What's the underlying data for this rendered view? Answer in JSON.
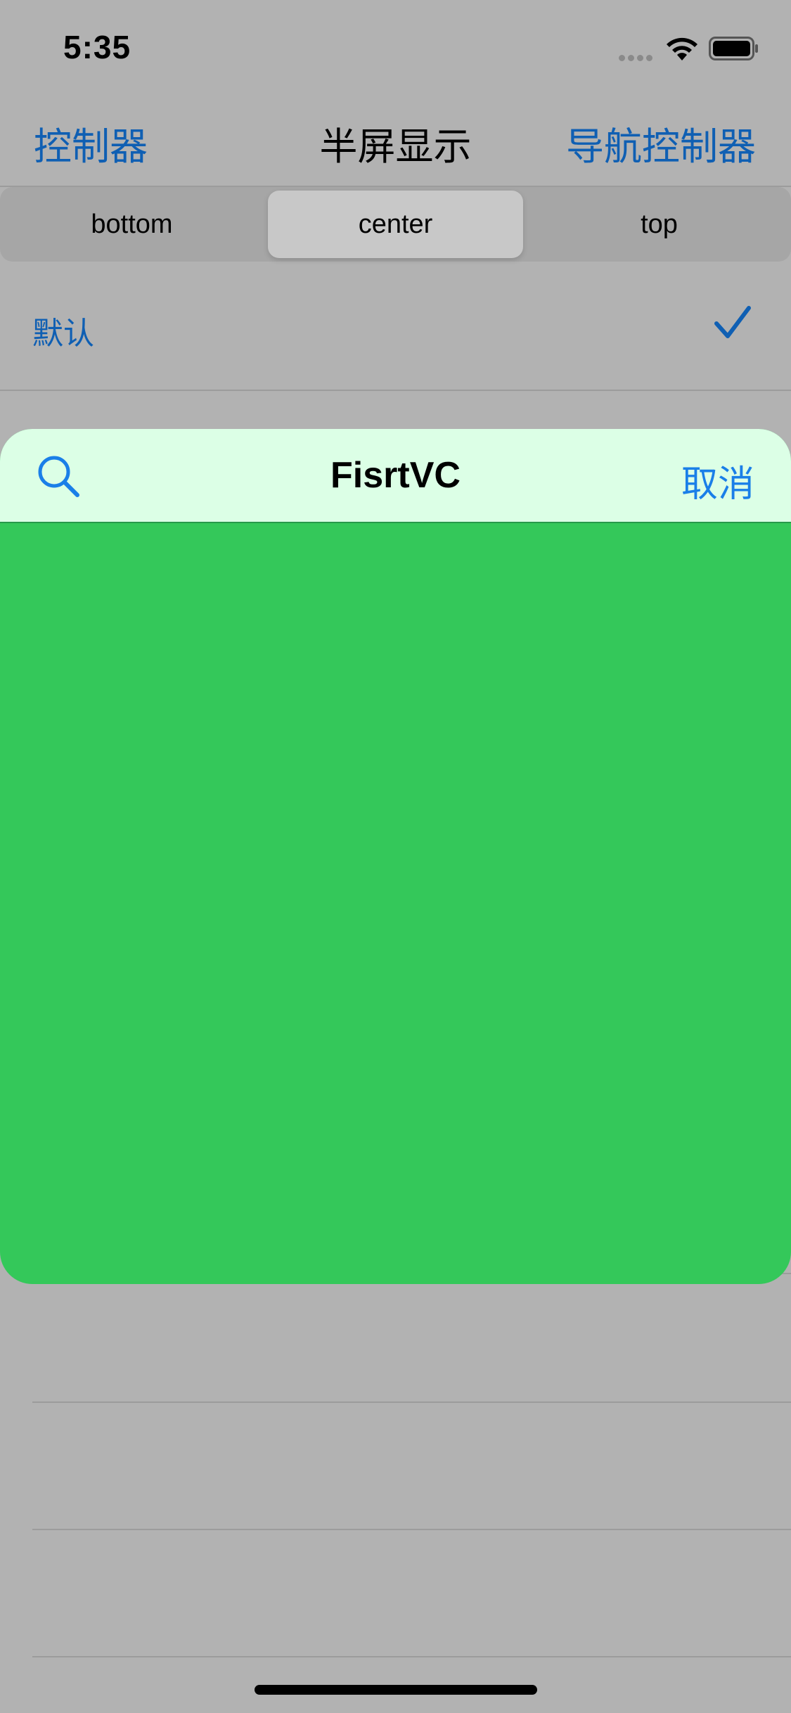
{
  "status_bar": {
    "time": "5:35"
  },
  "nav_bar": {
    "left_label": "控制器",
    "title": "半屏显示",
    "right_label": "导航控制器"
  },
  "segmented_control": {
    "segments": [
      "bottom",
      "center",
      "top"
    ],
    "selected": "center"
  },
  "list": {
    "default_row_label": "默认",
    "default_row_checked": true
  },
  "sheet": {
    "title": "FisrtVC",
    "cancel_label": "取消",
    "search_icon": "search-icon",
    "background_color": "#34c85a",
    "header_color": "#dcffe6"
  },
  "colors": {
    "accent": "#0f5fb3",
    "sheet_accent": "#1a7fe8",
    "dim_background": "#b2b2b2"
  }
}
